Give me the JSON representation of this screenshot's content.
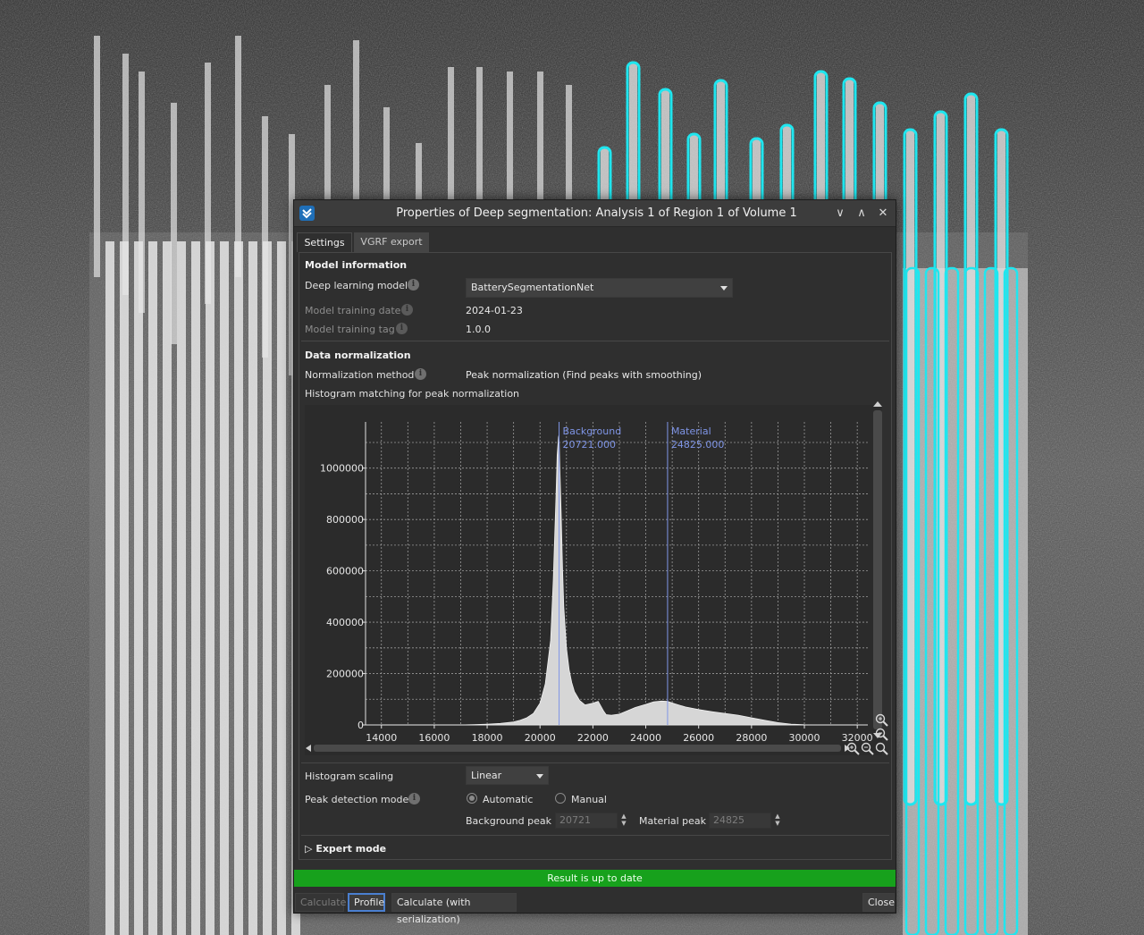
{
  "window": {
    "title": "Properties of Deep segmentation: Analysis 1 of Region 1 of Volume 1",
    "minimize_glyph": "∨",
    "maximize_glyph": "∧",
    "close_glyph": "✕",
    "icon": "app-logo-icon"
  },
  "tabs": [
    {
      "label": "Settings",
      "active": true
    },
    {
      "label": "VGRF export",
      "active": false
    }
  ],
  "model_info": {
    "title": "Model information",
    "model_label": "Deep learning model",
    "model_value": "BatterySegmentationNet",
    "date_label": "Model training date",
    "date_value": "2024-01-23",
    "tag_label": "Model training tag",
    "tag_value": "1.0.0"
  },
  "normalization": {
    "title": "Data normalization",
    "method_label": "Normalization method",
    "method_value": "Peak normalization (Find peaks with smoothing)",
    "histogram_label": "Histogram matching for peak normalization"
  },
  "chart_data": {
    "type": "area",
    "x": [
      14000,
      14500,
      15000,
      15500,
      16000,
      16500,
      17000,
      17500,
      18000,
      18500,
      19000,
      19250,
      19500,
      19750,
      20000,
      20200,
      20400,
      20500,
      20600,
      20650,
      20700,
      20721,
      20750,
      20800,
      20850,
      20900,
      21000,
      21100,
      21200,
      21300,
      21500,
      21700,
      22000,
      22200,
      22400,
      22500,
      22700,
      23000,
      23300,
      23600,
      24000,
      24300,
      24600,
      24825,
      25100,
      25500,
      26000,
      26500,
      27000,
      27500,
      28000,
      28500,
      29000,
      29500,
      30000,
      30500,
      31000,
      31500,
      32000
    ],
    "values": [
      0,
      0,
      0,
      0,
      0,
      0,
      0,
      1000,
      3000,
      6000,
      12000,
      18000,
      28000,
      45000,
      85000,
      160000,
      330000,
      560000,
      880000,
      1050000,
      1120000,
      1130000,
      1000000,
      820000,
      610000,
      460000,
      300000,
      215000,
      165000,
      130000,
      95000,
      78000,
      85000,
      92000,
      55000,
      40000,
      38000,
      42000,
      55000,
      68000,
      80000,
      90000,
      93000,
      92000,
      82000,
      70000,
      60000,
      52000,
      45000,
      38000,
      28000,
      18000,
      9000,
      3000,
      800,
      0,
      0,
      0,
      0
    ],
    "title": "",
    "xlabel": "",
    "ylabel": "",
    "xlim": [
      13400,
      32400
    ],
    "ylim": [
      0,
      1180000
    ],
    "x_ticks": [
      "14000",
      "16000",
      "18000",
      "20000",
      "22000",
      "24000",
      "26000",
      "28000",
      "30000",
      "32000"
    ],
    "y_ticks": [
      "0",
      "200000",
      "400000",
      "600000",
      "800000",
      "1000000"
    ],
    "grid": true,
    "markers": [
      {
        "name": "Background",
        "value": "20721.000",
        "x": 20721
      },
      {
        "name": "Material",
        "value": "24825.000",
        "x": 24825
      }
    ],
    "colors": {
      "fill": "#d6d6d6",
      "plot_bg": "#2b2b2b",
      "grid": "#9a9a9a",
      "marker": "#7f95e6"
    }
  },
  "controls": {
    "scaling_label": "Histogram scaling",
    "scaling_value": "Linear",
    "peak_mode_label": "Peak detection mode",
    "automatic_label": "Automatic",
    "manual_label": "Manual",
    "peak_mode_selected": "Automatic",
    "background_peak_label": "Background peak",
    "background_peak_value": "20721",
    "material_peak_label": "Material peak",
    "material_peak_value": "24825"
  },
  "expert": {
    "label": "Expert mode",
    "expanded": false
  },
  "status": {
    "text": "Result is up to date",
    "color": "#17a11c"
  },
  "buttons": {
    "calculate": "Calculate",
    "profile": "Profile",
    "calculate_serialization": "Calculate (with serialization)",
    "close": "Close"
  },
  "zoom_icons": [
    "zoom-in-icon",
    "zoom-out-icon",
    "zoom-reset-icon"
  ]
}
